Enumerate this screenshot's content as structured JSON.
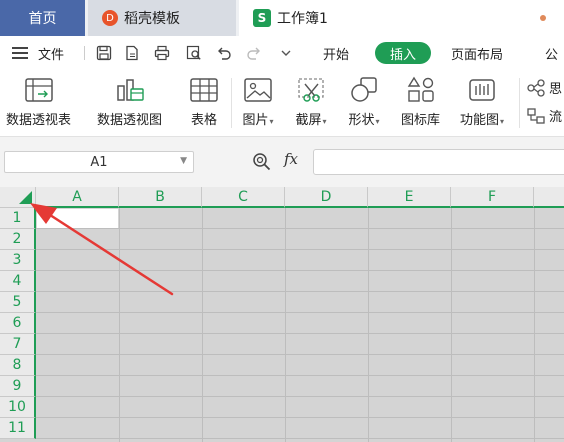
{
  "tabs": {
    "home": "首页",
    "docer": "稻壳模板",
    "docer_icon": "D",
    "workbook": "工作簿1",
    "workbook_icon": "S"
  },
  "menu": {
    "file": "文件",
    "start": "开始",
    "insert": "插入",
    "page_layout": "页面布局",
    "formula_partial": "公"
  },
  "ribbon": {
    "pivot_table": "数据透视表",
    "pivot_chart": "数据透视图",
    "table": "表格",
    "picture": "图片",
    "screenshot": "截屏",
    "shape": "形状",
    "icon_lib": "图标库",
    "func_chart": "功能图",
    "mind_partial": "思",
    "flow_partial": "流"
  },
  "formula_bar": {
    "cell_ref": "A1",
    "fx": "fx",
    "formula_value": ""
  },
  "grid": {
    "columns": [
      "A",
      "B",
      "C",
      "D",
      "E",
      "F"
    ],
    "rows": [
      "1",
      "2",
      "3",
      "4",
      "5",
      "6",
      "7",
      "8",
      "9",
      "10",
      "11"
    ]
  },
  "colors": {
    "accent": "#1f9d55",
    "home_tab": "#4a68a8",
    "arrow": "#e53935"
  }
}
